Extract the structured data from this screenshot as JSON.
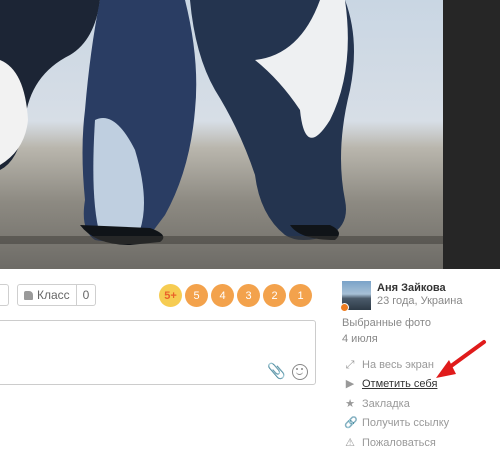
{
  "photo": {
    "alt_icon": "penguins-photo"
  },
  "actions_bar": {
    "class_label": "Класс",
    "class_count": "0",
    "ratings": [
      "5+",
      "5",
      "4",
      "3",
      "2",
      "1"
    ]
  },
  "author": {
    "name": "Аня Зайкова",
    "info": "23 года, Украина"
  },
  "album": "Выбранные фото",
  "date": "4 июля",
  "menu": [
    {
      "icon": "expand-icon",
      "label": "На весь экран"
    },
    {
      "icon": "play-icon",
      "label": "Отметить себя"
    },
    {
      "icon": "star-icon",
      "label": "Закладка"
    },
    {
      "icon": "link-icon",
      "label": "Получить ссылку"
    },
    {
      "icon": "warning-icon",
      "label": "Пожаловаться"
    }
  ],
  "colors": {
    "accent": "#f3a24c",
    "gold": "#f6cc52",
    "arrow": "#e01b1b"
  }
}
